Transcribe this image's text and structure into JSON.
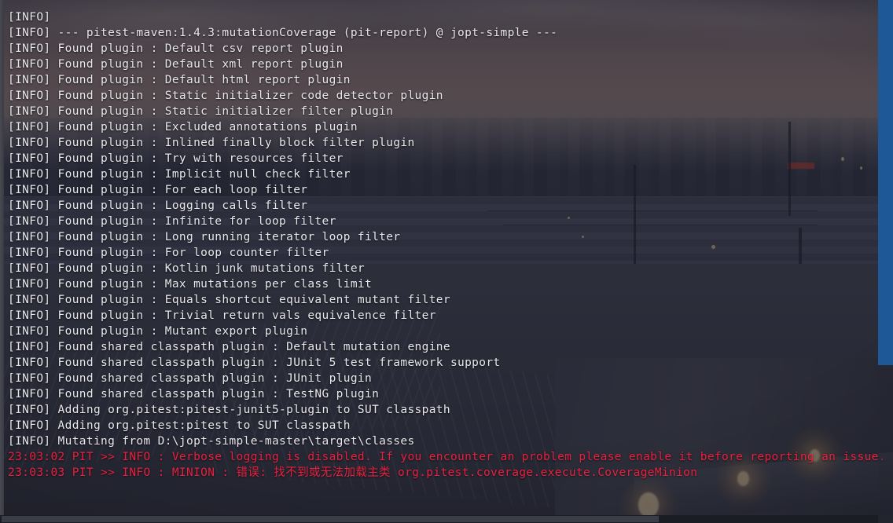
{
  "window": {
    "type": "terminal-console",
    "app": "maven-build-console"
  },
  "colors": {
    "info_text": "#e8e8ec",
    "error_text": "#e8213f",
    "scrollbar_thumb": "#1f5896",
    "overlay": "rgba(30,32,44,0.58)"
  },
  "scrollbars": {
    "vertical_name": "vertical-scrollbar",
    "horizontal_name": "horizontal-scrollbar"
  },
  "console": {
    "lines": [
      {
        "text": "[INFO]",
        "level": "info"
      },
      {
        "text": "[INFO] --- pitest-maven:1.4.3:mutationCoverage (pit-report) @ jopt-simple ---",
        "level": "info"
      },
      {
        "text": "[INFO] Found plugin : Default csv report plugin",
        "level": "info"
      },
      {
        "text": "[INFO] Found plugin : Default xml report plugin",
        "level": "info"
      },
      {
        "text": "[INFO] Found plugin : Default html report plugin",
        "level": "info"
      },
      {
        "text": "[INFO] Found plugin : Static initializer code detector plugin",
        "level": "info"
      },
      {
        "text": "[INFO] Found plugin : Static initializer filter plugin",
        "level": "info"
      },
      {
        "text": "[INFO] Found plugin : Excluded annotations plugin",
        "level": "info"
      },
      {
        "text": "[INFO] Found plugin : Inlined finally block filter plugin",
        "level": "info"
      },
      {
        "text": "[INFO] Found plugin : Try with resources filter",
        "level": "info"
      },
      {
        "text": "[INFO] Found plugin : Implicit null check filter",
        "level": "info"
      },
      {
        "text": "[INFO] Found plugin : For each loop filter",
        "level": "info"
      },
      {
        "text": "[INFO] Found plugin : Logging calls filter",
        "level": "info"
      },
      {
        "text": "[INFO] Found plugin : Infinite for loop filter",
        "level": "info"
      },
      {
        "text": "[INFO] Found plugin : Long running iterator loop filter",
        "level": "info"
      },
      {
        "text": "[INFO] Found plugin : For loop counter filter",
        "level": "info"
      },
      {
        "text": "[INFO] Found plugin : Kotlin junk mutations filter",
        "level": "info"
      },
      {
        "text": "[INFO] Found plugin : Max mutations per class limit",
        "level": "info"
      },
      {
        "text": "[INFO] Found plugin : Equals shortcut equivalent mutant filter",
        "level": "info"
      },
      {
        "text": "[INFO] Found plugin : Trivial return vals equivalence filter",
        "level": "info"
      },
      {
        "text": "[INFO] Found plugin : Mutant export plugin",
        "level": "info"
      },
      {
        "text": "[INFO] Found shared classpath plugin : Default mutation engine",
        "level": "info"
      },
      {
        "text": "[INFO] Found shared classpath plugin : JUnit 5 test framework support",
        "level": "info"
      },
      {
        "text": "[INFO] Found shared classpath plugin : JUnit plugin",
        "level": "info"
      },
      {
        "text": "[INFO] Found shared classpath plugin : TestNG plugin",
        "level": "info"
      },
      {
        "text": "[INFO] Adding org.pitest:pitest-junit5-plugin to SUT classpath",
        "level": "info"
      },
      {
        "text": "[INFO] Adding org.pitest:pitest to SUT classpath",
        "level": "info"
      },
      {
        "text": "[INFO] Mutating from D:\\jopt-simple-master\\target\\classes",
        "level": "info"
      },
      {
        "text": "23:03:02 PIT >> INFO : Verbose logging is disabled. If you encounter an problem please enable it before reporting an issue.",
        "level": "error"
      },
      {
        "text": "23:03:03 PIT >> INFO : MINION : 错误: 找不到或无法加载主类 org.pitest.coverage.execute.CoverageMinion",
        "level": "error"
      }
    ]
  }
}
